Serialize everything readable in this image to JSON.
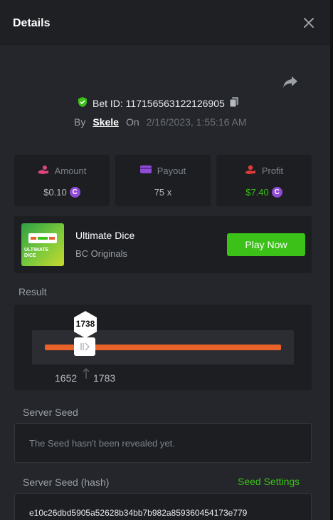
{
  "header": {
    "title": "Details"
  },
  "bet": {
    "id_label": "Bet ID: 117156563122126905",
    "by_label": "By",
    "user": "Skele",
    "on_label": "On",
    "date": "2/16/2023, 1:55:16 AM"
  },
  "stats": [
    {
      "label": "Amount",
      "value": "$0.10",
      "value_color": "#b5b9bf",
      "icon": "hand-coin-icon"
    },
    {
      "label": "Payout",
      "value": "75 x",
      "value_color": "#b5b9bf",
      "icon": "wallet-icon"
    },
    {
      "label": "Profit",
      "value": "$7.40",
      "value_color": "#3bc117",
      "icon": "profit-hand-icon"
    }
  ],
  "game": {
    "name": "Ultimate Dice",
    "provider": "BC Originals",
    "thumb_text": "ULTIMATE DICE",
    "play_label": "Play Now"
  },
  "result": {
    "label": "Result",
    "value": "1738",
    "range_low": "1652",
    "range_high": "1783"
  },
  "server_seed": {
    "label": "Server Seed",
    "message": "The Seed hasn't been revealed yet."
  },
  "server_seed_hash": {
    "label": "Server Seed (hash)",
    "settings_label": "Seed Settings",
    "value": "e10c26dbd5905a52628b34bb7b982a859360454173e779"
  },
  "colors": {
    "accent_green": "#3bc117",
    "slider_orange": "#e8622a",
    "coin_purple": "#8f4bd6"
  }
}
